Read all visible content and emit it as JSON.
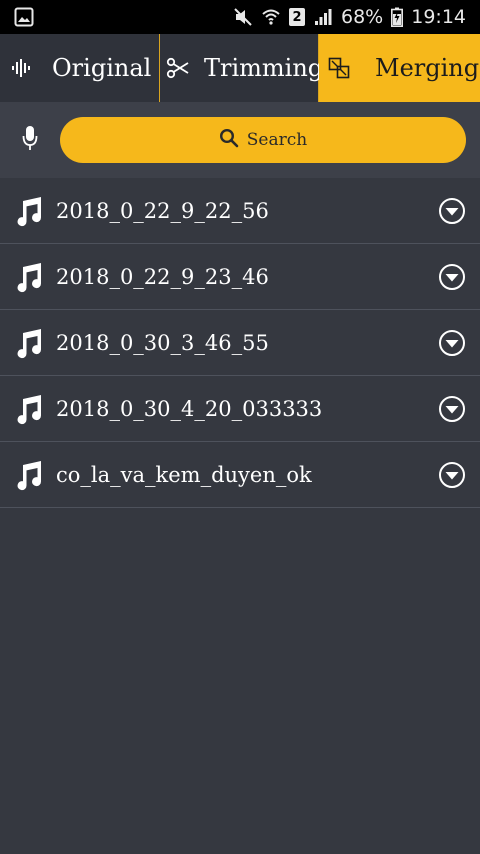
{
  "status_bar": {
    "battery": "68%",
    "time": "19:14",
    "sim": "2"
  },
  "tabs": [
    {
      "label": "Original",
      "icon": "waveform-icon",
      "active": false
    },
    {
      "label": "Trimming",
      "icon": "scissors-icon",
      "active": false
    },
    {
      "label": "Merging",
      "icon": "merge-icon",
      "active": true
    }
  ],
  "search": {
    "label": "Search"
  },
  "files": [
    {
      "name": "2018_0_22_9_22_56"
    },
    {
      "name": "2018_0_22_9_23_46"
    },
    {
      "name": "2018_0_30_3_46_55"
    },
    {
      "name": "2018_0_30_4_20_033333"
    },
    {
      "name": "co_la_va_kem_duyen_ok"
    }
  ],
  "colors": {
    "accent": "#f6b81b",
    "background": "#353840",
    "tab_background": "#2f323a",
    "search_row_background": "#3d4049",
    "status_bar": "#000000"
  }
}
